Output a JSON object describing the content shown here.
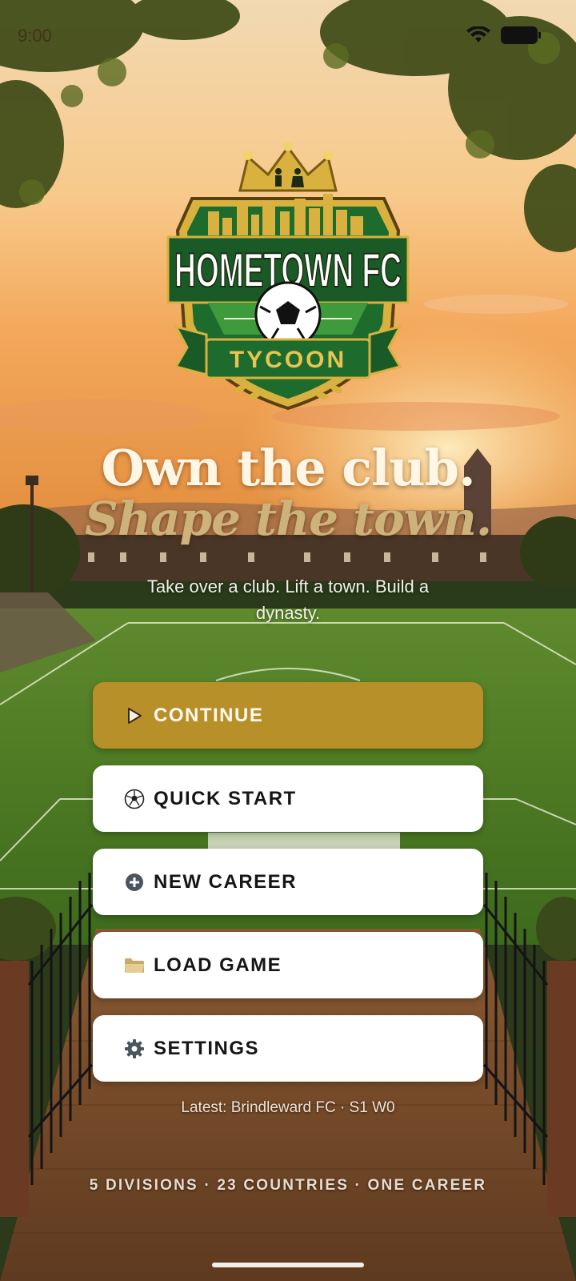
{
  "status_bar": {
    "time": "9:00"
  },
  "logo": {
    "name_line": "HOMETOWN FC",
    "banner": "TYCOON"
  },
  "hero": {
    "headline_line1": "Own the club.",
    "headline_line2": "Shape the town.",
    "tagline": "Take over a club. Lift a town. Build a dynasty."
  },
  "menu": {
    "continue_label": "CONTINUE",
    "quick_start_label": "QUICK START",
    "new_career_label": "NEW CAREER",
    "load_game_label": "LOAD GAME",
    "settings_label": "SETTINGS"
  },
  "icons": {
    "continue": "play-icon",
    "quick_start": "soccer-ball-icon",
    "new_career": "plus-circle-icon",
    "load_game": "folder-icon",
    "settings": "gear-icon"
  },
  "latest_save": "Latest: Brindleward FC · S1 W0",
  "footer": "5 DIVISIONS · 23 COUNTRIES · ONE CAREER",
  "colors": {
    "primary_button": "#b8902a",
    "secondary_button": "#ffffff",
    "crest_green": "#1e6b2e",
    "crest_gold": "#d8b13e"
  }
}
